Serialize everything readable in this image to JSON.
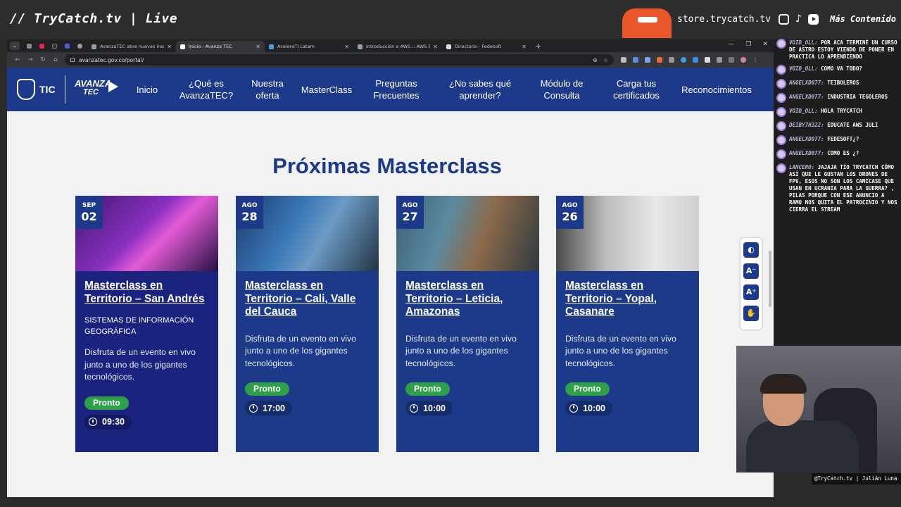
{
  "stream": {
    "title": "// TryCatch.tv | Live",
    "store_url": "store.trycatch.tv",
    "more_content": "Más Contenido",
    "cam_label": "@TryCatch.tv | Julián Luna"
  },
  "browser": {
    "tabs": [
      {
        "label": "AvanzaTEC abre nuevas inscripc",
        "active": false
      },
      {
        "label": "Inicio - Avanza TEC",
        "active": true
      },
      {
        "label": "AceleraTI Latam",
        "active": false
      },
      {
        "label": "Introducción a AWS :: AWS Ent",
        "active": false
      },
      {
        "label": "Directorio - Fedesoft",
        "active": false
      }
    ],
    "url": "avanzatec.gov.co/portal/"
  },
  "site": {
    "logo_tic": "TIC",
    "logo_avanza_1": "AVANZA",
    "logo_avanza_2": "TEC",
    "nav": [
      {
        "label": "Inicio"
      },
      {
        "label": "¿Qué es AvanzaTEC?"
      },
      {
        "label": "Nuestra oferta"
      },
      {
        "label": "MasterClass"
      },
      {
        "label": "Preguntas Frecuentes"
      },
      {
        "label": "¿No sabes qué aprender?"
      },
      {
        "label": "Módulo de Consulta"
      },
      {
        "label": "Carga tus certificados"
      },
      {
        "label": "Reconocimientos"
      }
    ],
    "heading": "Próximas Masterclass",
    "cards": [
      {
        "month": "SEP",
        "day": "02",
        "title": "Masterclass en Territorio – San Andrés",
        "subcategory": "SISTEMAS DE INFORMACIÓN GEOGRÁFICA",
        "description": "Disfruta de un evento en vivo junto a uno de los gigantes tecnológicos.",
        "status": "Pronto",
        "time": "09:30"
      },
      {
        "month": "AGO",
        "day": "28",
        "title": "Masterclass en Territorio – Cali, Valle del Cauca",
        "subcategory": "",
        "description": "Disfruta de un evento en vivo junto a uno de los gigantes tecnológicos.",
        "status": "Pronto",
        "time": "17:00"
      },
      {
        "month": "AGO",
        "day": "27",
        "title": "Masterclass en Territorio – Leticia, Amazonas",
        "subcategory": "",
        "description": "Disfruta de un evento en vivo junto a uno de los gigantes tecnológicos.",
        "status": "Pronto",
        "time": "10:00"
      },
      {
        "month": "AGO",
        "day": "26",
        "title": "Masterclass en Territorio – Yopal, Casanare",
        "subcategory": "",
        "description": "Disfruta de un evento en vivo junto a uno de los gigantes tecnológicos.",
        "status": "Pronto",
        "time": "10:00"
      }
    ],
    "a11y_buttons": [
      "◐",
      "A⁻",
      "A⁺",
      "✋"
    ]
  },
  "chat": [
    {
      "user": "VOID_OLL:",
      "text": "POR ACA TERMINÉ UN CURSO DE ASTRO ESTOY VIENDO DE PONER EN PRACTICA LO APRENDIENDO"
    },
    {
      "user": "VOID_OLL:",
      "text": "COMO VA TODO?"
    },
    {
      "user": "ANGELXD077:",
      "text": "TEIBOLEROS"
    },
    {
      "user": "ANGELXD077:",
      "text": "INDUSTRIA TEGOLEROS"
    },
    {
      "user": "VOID_OLL:",
      "text": "HOLA TRYCATCH"
    },
    {
      "user": "DEIBY7H322:",
      "text": "EDUCATE AWS JULI"
    },
    {
      "user": "ANGELXD077:",
      "text": "FEDESOFT¿?"
    },
    {
      "user": "ANGELXD077:",
      "text": "COMO ES ¿?"
    },
    {
      "user": "LANCERO:",
      "text": "JAJAJA TÍO TRYCATCH CÓMO ASÍ QUE LE GUSTAN LOS DRONES DE FPV, ESOS NO SON LOS CAMICASE QUE USAN EN UCRANIA PARA LA GUERRA? , PILAS PORQUE CON ESE ANUNCIO A RAMO NOS QUITA EL PATROCINIO Y NOS CIERRA EL STREAM"
    }
  ]
}
